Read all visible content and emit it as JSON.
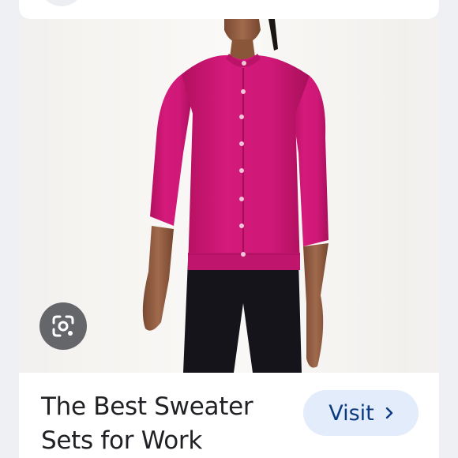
{
  "result": {
    "title_line1": "The Best Sweater",
    "title_line2": "Sets for Work",
    "visit_label": "Visit"
  },
  "image": {
    "subject": "model wearing magenta crewneck cardigan with black pants"
  },
  "icons": {
    "lens": "google-lens-icon",
    "chevron": "chevron-right-icon"
  },
  "colors": {
    "sweater": "#d0187a",
    "visit_bg": "#e3ecfa",
    "visit_text": "#0b3a80",
    "lens_bg": "#505256"
  }
}
